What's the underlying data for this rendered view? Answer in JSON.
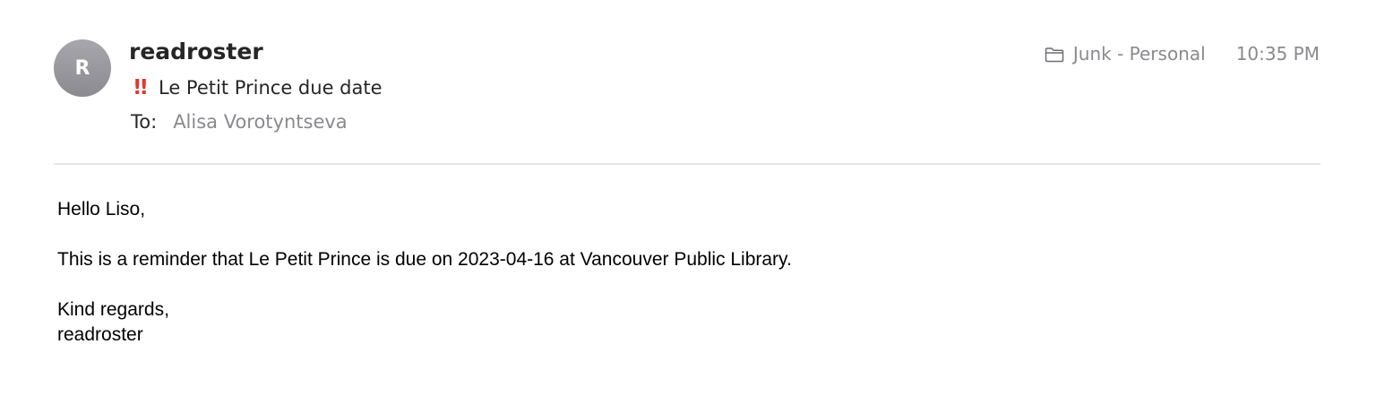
{
  "message": {
    "avatar_initial": "R",
    "sender": "readroster",
    "priority_flag": "!!",
    "subject": "Le Petit Prince due date",
    "to_label": "To:",
    "to_name": "Alisa Vorotyntseva",
    "folder": "Junk - Personal",
    "time": "10:35 PM",
    "icons": {
      "folder": "folder-icon",
      "priority": "priority-high-icon"
    },
    "colors": {
      "avatar": "#9a9aa0",
      "priority": "#e03a2e",
      "muted_text": "#8a8a8e"
    }
  },
  "body": {
    "greeting": "Hello Liso,",
    "content": "This is a reminder that Le Petit Prince is due on 2023-04-16 at Vancouver Public Library.",
    "closing": "Kind regards,",
    "signature": "readroster"
  }
}
